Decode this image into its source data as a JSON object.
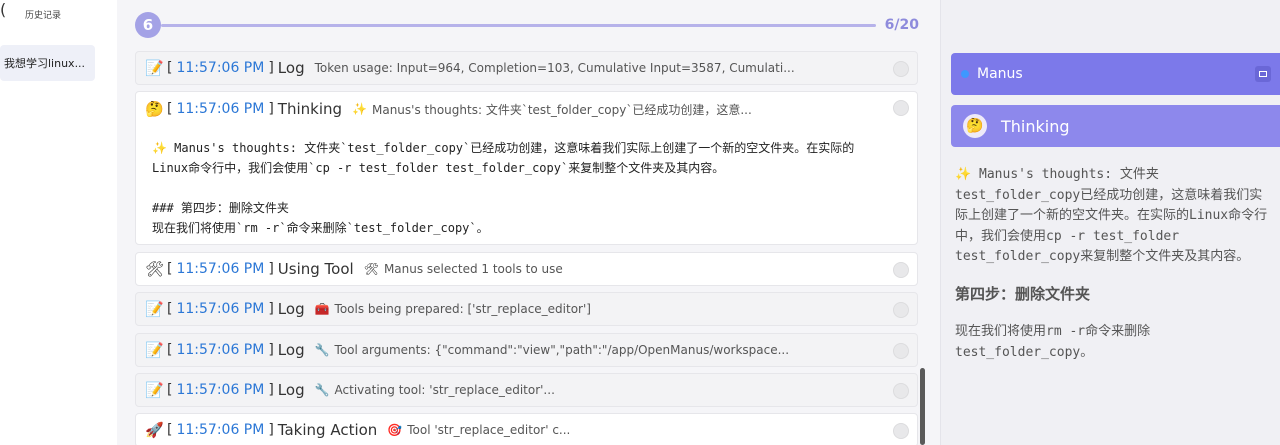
{
  "sidebar": {
    "history_label": "历史记录",
    "conversation": "我想学习linux..."
  },
  "progress": {
    "step": "6",
    "counter": "6/20"
  },
  "events": [
    {
      "emoji": "📝",
      "time": "11:57:06 PM",
      "type": "Log",
      "emoji2": "",
      "msg": "Token usage: Input=964, Completion=103, Cumulative Input=3587, Cumulati..."
    },
    {
      "emoji": "🤔",
      "time": "11:57:06 PM",
      "type": "Thinking",
      "emoji2": "✨",
      "msg": "Manus's thoughts: 文件夹`test_folder_copy`已经成功创建，这意..."
    },
    {
      "emoji": "🛠",
      "time": "11:57:06 PM",
      "type": "Using Tool",
      "emoji2": "🛠",
      "msg": "Manus selected 1 tools to use"
    },
    {
      "emoji": "📝",
      "time": "11:57:06 PM",
      "type": "Log",
      "emoji2": "🧰",
      "msg": "Tools being prepared: ['str_replace_editor']"
    },
    {
      "emoji": "📝",
      "time": "11:57:06 PM",
      "type": "Log",
      "emoji2": "🔧",
      "msg": "Tool arguments: {\"command\":\"view\",\"path\":\"/app/OpenManus/workspace..."
    },
    {
      "emoji": "📝",
      "time": "11:57:06 PM",
      "type": "Log",
      "emoji2": "🔧",
      "msg": "Activating tool: 'str_replace_editor'..."
    },
    {
      "emoji": "🚀",
      "time": "11:57:06 PM",
      "type": "Taking Action",
      "emoji2": "🎯",
      "msg": "Tool 'str_replace_editor' c..."
    }
  ],
  "thinking_body": "✨ Manus's thoughts: 文件夹`test_folder_copy`已经成功创建，这意味着我们实际上创建了一个新的空文件夹。在实际的\nLinux命令行中，我们会使用`cp -r test_folder test_folder_copy`来复制整个文件夹及其内容。\n\n### 第四步：删除文件夹\n现在我们将使用`rm -r`命令来删除`test_folder_copy`。",
  "panel": {
    "title": "Manus",
    "section": "Thinking",
    "para1": "✨ Manus's thoughts: 文件夹test_folder_copy已经成功创建，这意味着我们实际上创建了一个新的空文件夹。在实际的Linux命令行中，我们会使用cp -r test_folder test_folder_copy来复制整个文件夹及其内容。",
    "heading": "第四步：删除文件夹",
    "para2": "现在我们将使用rm -r命令来删除test_folder_copy。"
  },
  "colors": {
    "accent": "#7c79ea",
    "time": "#2b77d6"
  }
}
